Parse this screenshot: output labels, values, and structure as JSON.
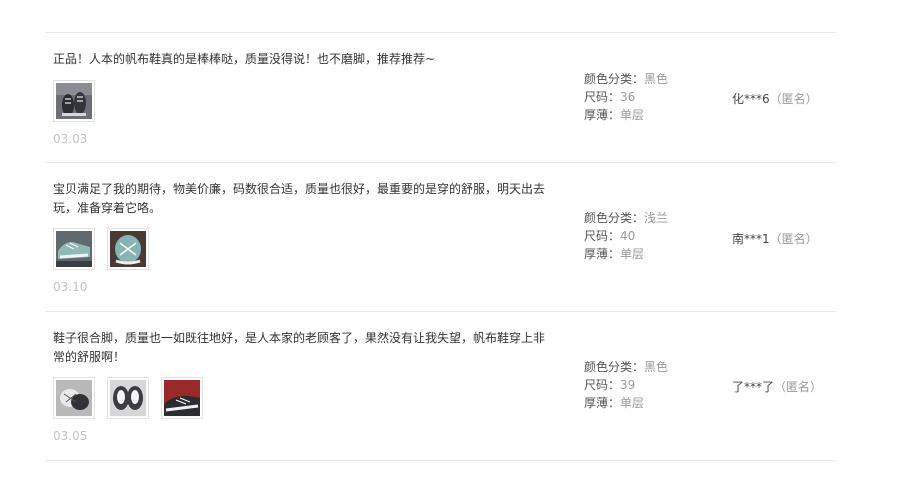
{
  "reviews": [
    {
      "text": "正品！人本的帆布鞋真的是棒棒哒，质量没得说！也不磨脚，推荐推荐~",
      "photos": [
        "shoe-photo-1"
      ],
      "date": "03.03",
      "sku": {
        "color_label": "颜色分类：",
        "color": "黑色",
        "size_label": "尺码：",
        "size": "36",
        "thickness_label": "厚薄：",
        "thickness": "单层"
      },
      "user": {
        "name": "化***6",
        "anon": "（匿名）"
      }
    },
    {
      "text": "宝贝满足了我的期待，物美价廉，码数很合适，质量也很好，最重要的是穿的舒服，明天出去玩，准备穿着它咯。",
      "photos": [
        "shoe-photo-1",
        "shoe-photo-2"
      ],
      "date": "03.10",
      "sku": {
        "color_label": "颜色分类：",
        "color": "浅兰",
        "size_label": "尺码：",
        "size": "40",
        "thickness_label": "厚薄：",
        "thickness": "单层"
      },
      "user": {
        "name": "南***1",
        "anon": "（匿名）"
      }
    },
    {
      "text": "鞋子很合脚，质量也一如既往地好，是人本家的老顾客了，果然没有让我失望，帆布鞋穿上非常的舒服啊！",
      "photos": [
        "shoe-photo-1",
        "shoe-photo-2",
        "shoe-photo-3"
      ],
      "date": "03.05",
      "sku": {
        "color_label": "颜色分类：",
        "color": "黑色",
        "size_label": "尺码：",
        "size": "39",
        "thickness_label": "厚薄：",
        "thickness": "单层"
      },
      "user": {
        "name": "了***了",
        "anon": "（匿名）"
      }
    }
  ]
}
